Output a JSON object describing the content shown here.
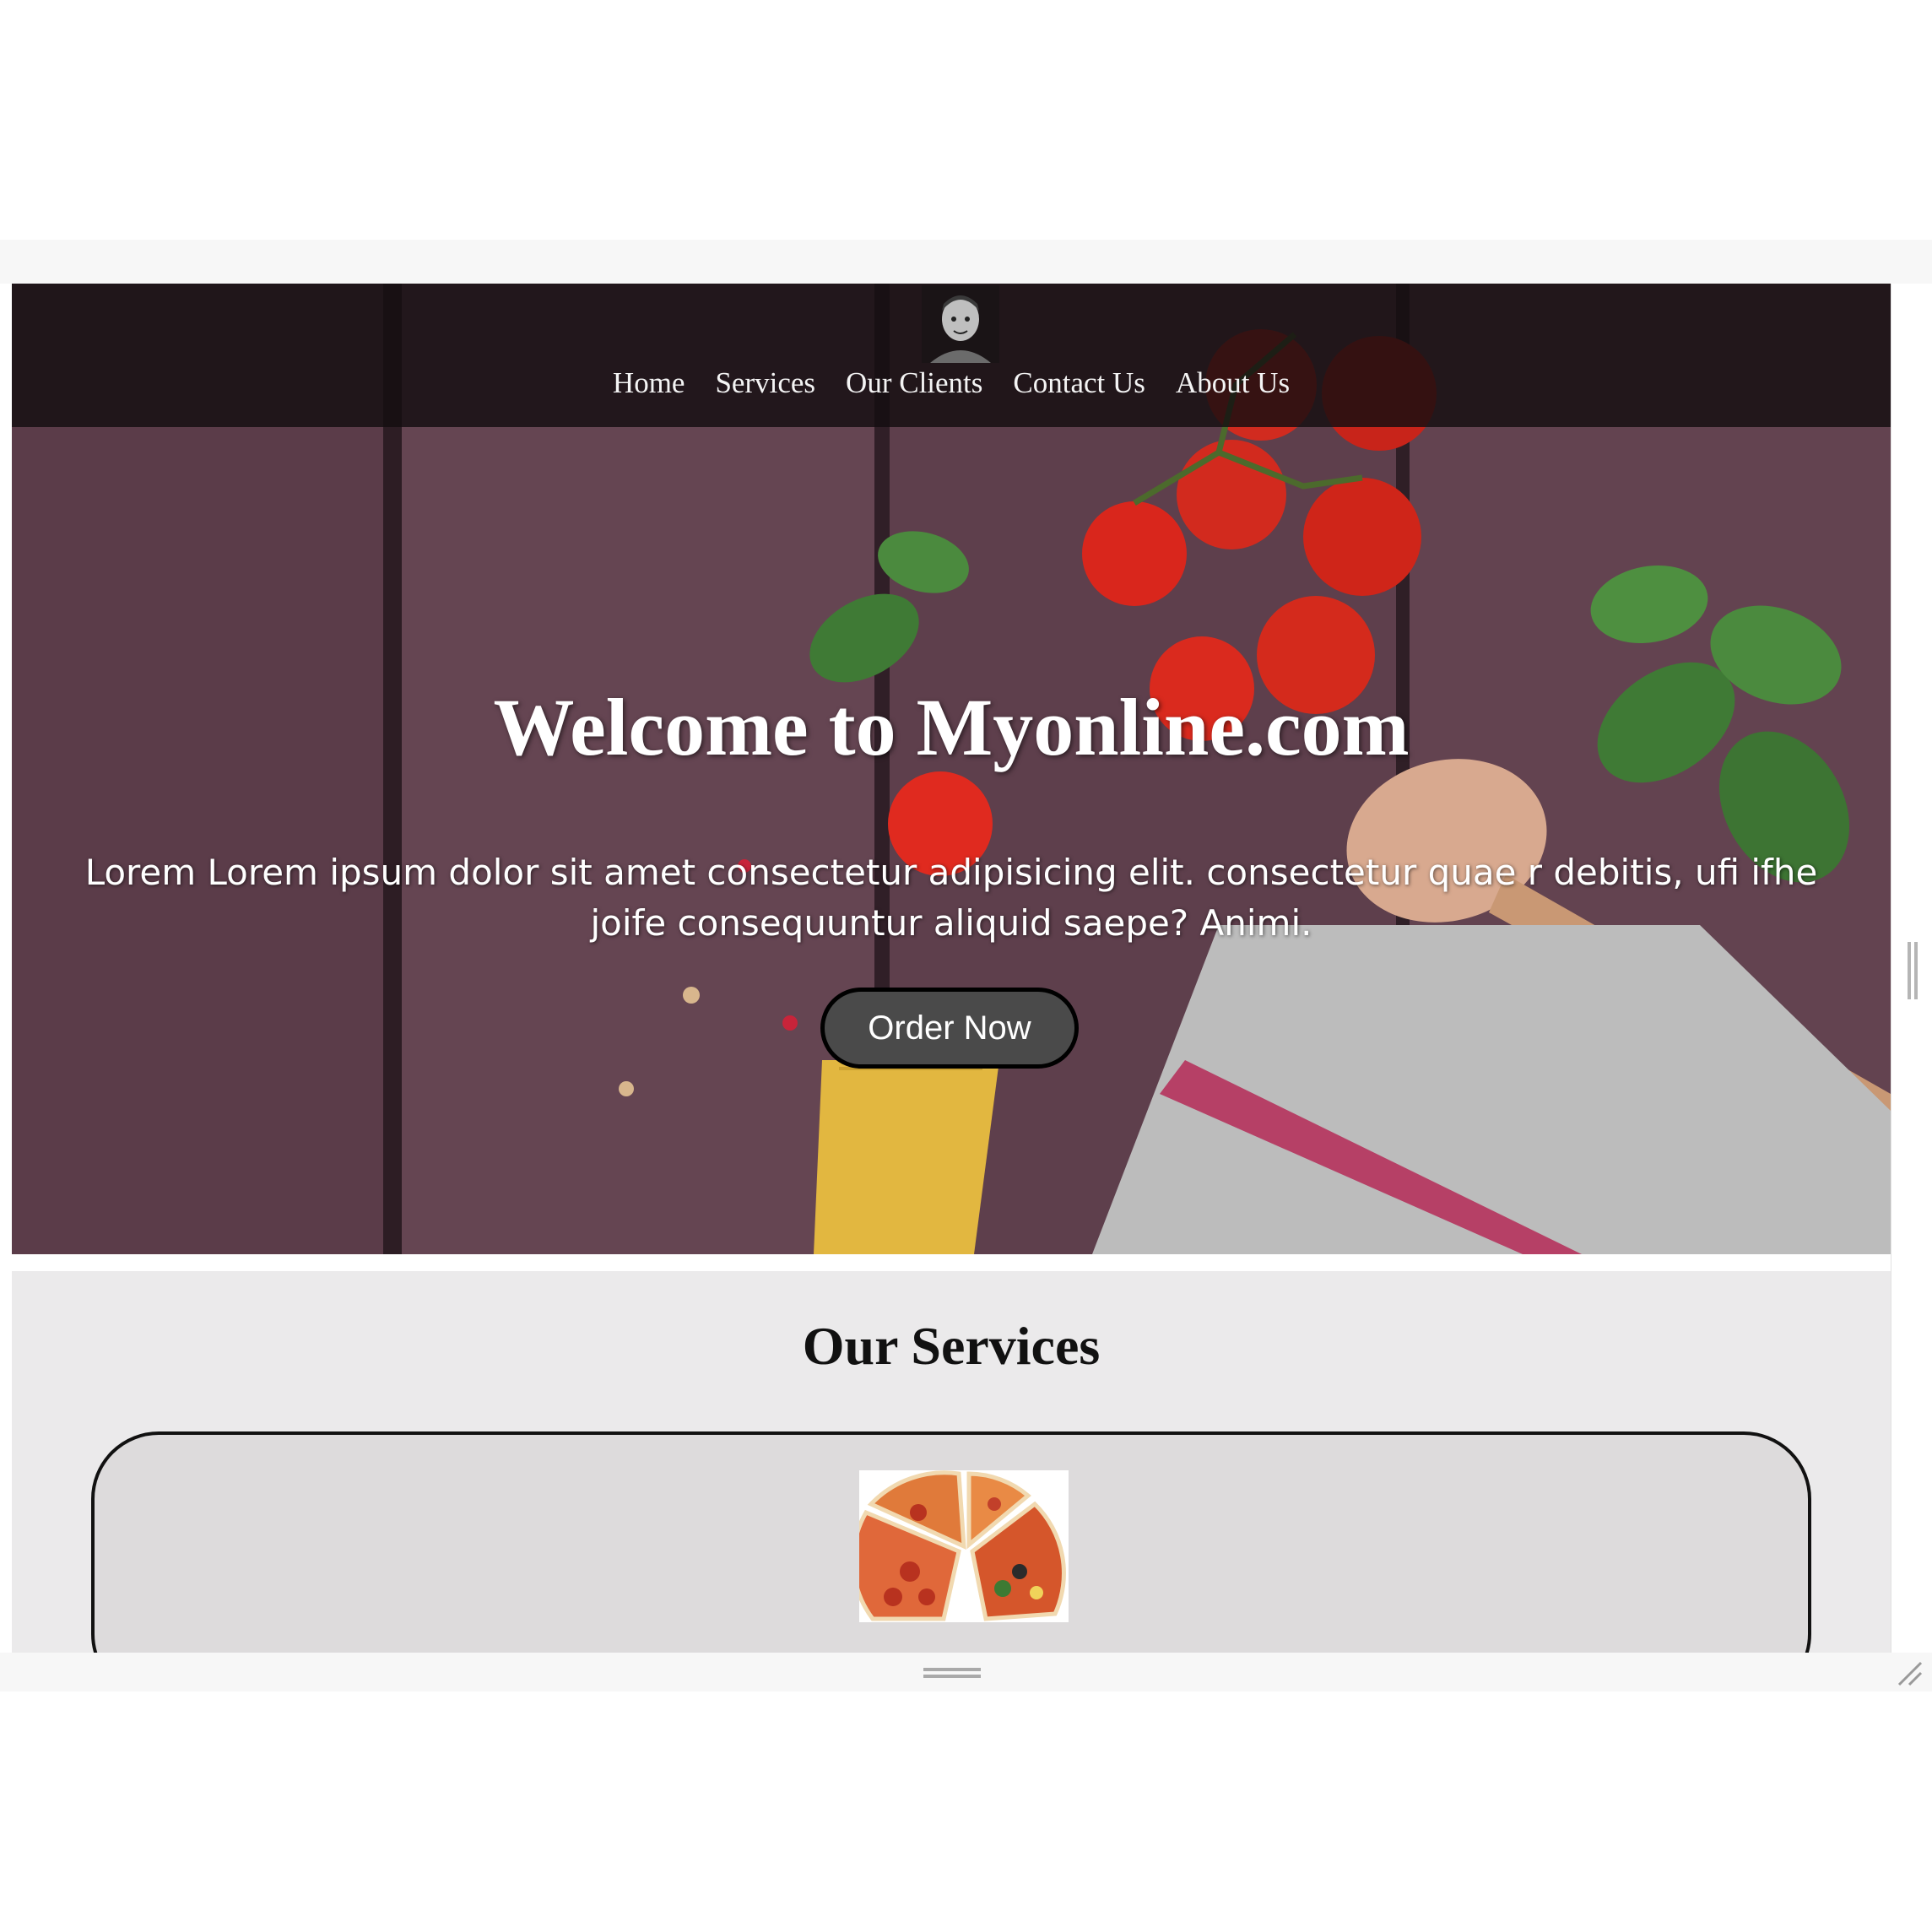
{
  "nav": {
    "items": [
      "Home",
      "Services",
      "Our Clients",
      "Contact Us",
      "About Us"
    ]
  },
  "hero": {
    "title": "Welcome to Myonline.com",
    "text": "Lorem Lorem ipsum dolor sit amet consectetur adipisicing elit. consectetur quae r debitis, ufi ifhe joife consequuntur aliquid saepe? Animi.",
    "button_label": "Order Now"
  },
  "services": {
    "title": "Our Services"
  },
  "icons": {
    "logo": "avatar-logo-icon",
    "pizza": "pizza-image-icon",
    "resize": "resize-handle-icon"
  },
  "colors": {
    "nav_bg": "#140e10",
    "button_bg": "#4a4a4a",
    "services_bg": "#ebeaeb",
    "card_bg": "#dddbdc"
  }
}
